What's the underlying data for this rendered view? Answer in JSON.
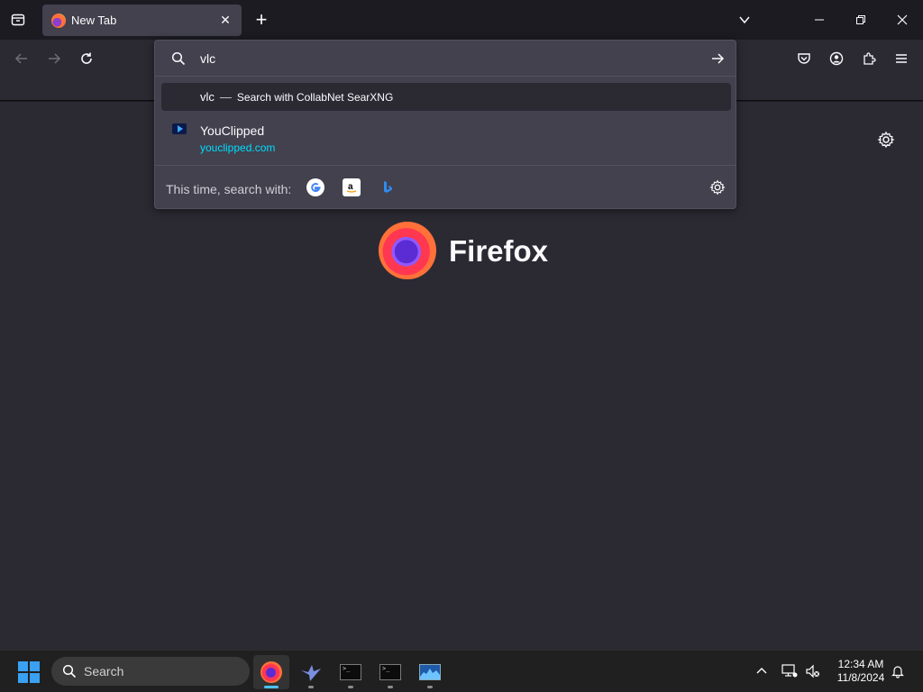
{
  "tabbar": {
    "tab": {
      "title": "New Tab"
    }
  },
  "urlbar": {
    "value": "vlc",
    "results": [
      {
        "text": "vlc",
        "separator": "—",
        "action": "Search with CollabNet SearXNG"
      },
      {
        "title": "YouClipped",
        "url": "youclipped.com"
      }
    ],
    "oneoff": {
      "label": "This time, search with:",
      "engines": [
        "google-icon",
        "amazon-icon",
        "bing-icon"
      ]
    }
  },
  "newtab": {
    "logo_text": "Firefox"
  },
  "taskbar": {
    "search_label": "Search",
    "time": "12:34 AM",
    "date": "11/8/2024"
  },
  "colors": {
    "accent": "#00ddff",
    "background": "#2b2a33",
    "panel": "#42414d"
  }
}
